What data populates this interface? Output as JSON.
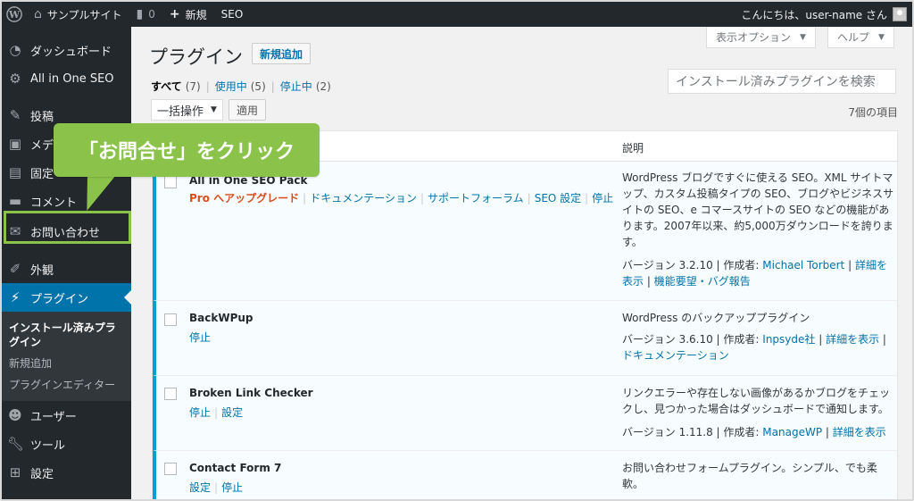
{
  "adminbar": {
    "site_name": "サンプルサイト",
    "comments_count": "0",
    "new_label": "新規",
    "seo_label": "SEO",
    "greeting": "こんにちは、user-name さん"
  },
  "sidebar": {
    "items": [
      {
        "label": "ダッシュボード",
        "icon": "dashboard-icon"
      },
      {
        "label": "All in One SEO",
        "icon": "gear-icon"
      },
      {
        "label": "投稿",
        "icon": "pin-icon"
      },
      {
        "label": "メデ",
        "icon": "media-icon"
      },
      {
        "label": "固定",
        "icon": "page-icon"
      },
      {
        "label": "コメント",
        "icon": "comment-icon"
      },
      {
        "label": "お問い合わせ",
        "icon": "mail-icon"
      },
      {
        "label": "外観",
        "icon": "brush-icon"
      },
      {
        "label": "プラグイン",
        "icon": "plug-icon"
      },
      {
        "label": "ユーザー",
        "icon": "user-icon"
      },
      {
        "label": "ツール",
        "icon": "wrench-icon"
      },
      {
        "label": "設定",
        "icon": "settings-icon"
      }
    ],
    "submenu": {
      "installed": "インストール済みプラグイン",
      "add_new": "新規追加",
      "editor": "プラグインエディター"
    }
  },
  "callout": {
    "text": "「お問合せ」をクリック",
    "color": "#8bc34a"
  },
  "header": {
    "title": "プラグイン",
    "add_new": "新規追加",
    "screen_options": "表示オプション",
    "help": "ヘルプ",
    "search_placeholder": "インストール済みプラグインを検索"
  },
  "filters": {
    "all": "すべて",
    "all_count": "(7)",
    "active": "使用中",
    "active_count": "(5)",
    "inactive": "停止中",
    "inactive_count": "(2)"
  },
  "bulk": {
    "select": "一括操作",
    "apply": "適用",
    "items_count": "7個の項目"
  },
  "table": {
    "col_desc": "説明",
    "rows": [
      {
        "name": "All in One SEO Pack",
        "actions": [
          "Pro へアップグレード",
          "ドキュメンテーション",
          "サポートフォーラム",
          "SEO 設定",
          "停止"
        ],
        "desc": "WordPress ブログですぐに使える SEO。XML サイトマップ、カスタム投稿タイプの SEO、ブログやビジネスサイトの SEO、e コマースサイトの SEO などの機能があります。2007年以来、約5,000万ダウンロードを誇ります。",
        "version": "バージョン 3.2.10 | 作成者: ",
        "author": "Michael Torbert",
        "detail": "詳細を表示",
        "extra": "機能要望・バグ報告"
      },
      {
        "name": "BackWPup",
        "actions": [
          "停止"
        ],
        "desc": "WordPress のバックアッププラグイン",
        "version": "バージョン 3.6.10 | 作成者: ",
        "author": "Inpsyde社",
        "detail": "詳細を表示",
        "extra": "ドキュメンテーション"
      },
      {
        "name": "Broken Link Checker",
        "actions": [
          "停止",
          "設定"
        ],
        "desc": "リンクエラーや存在しない画像があるかブログをチェックし、見つかった場合はダッシュボードで通知します。",
        "version": "バージョン 1.11.8 | 作成者: ",
        "author": "ManageWP",
        "detail": "詳細を表示"
      },
      {
        "name": "Contact Form 7",
        "actions": [
          "設定",
          "停止"
        ],
        "desc": "お問い合わせフォームプラグイン。シンプル、でも柔軟。"
      }
    ]
  }
}
